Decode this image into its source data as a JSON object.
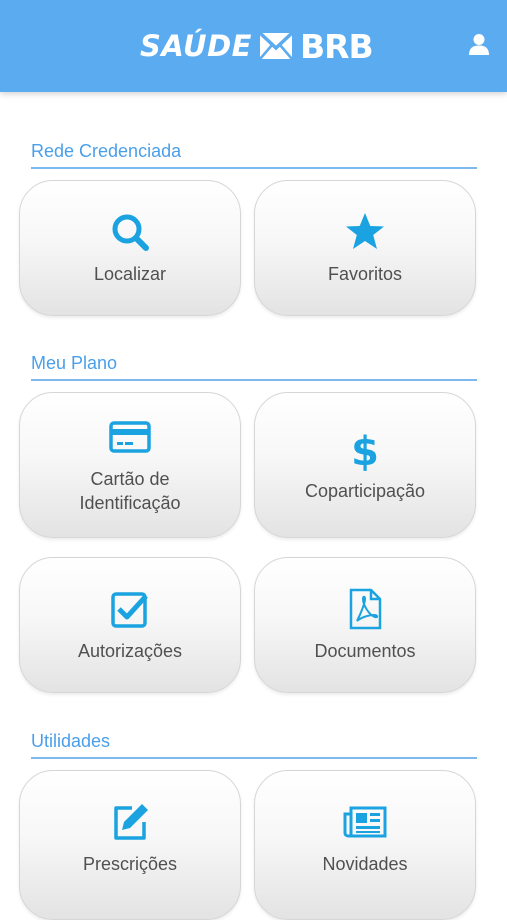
{
  "header": {
    "logo_left": "SAÚDE",
    "logo_right": "BRB",
    "user_icon": "user-icon"
  },
  "sections": [
    {
      "title": "Rede Credenciada",
      "tiles": [
        {
          "label": "Localizar",
          "icon": "search-icon"
        },
        {
          "label": "Favoritos",
          "icon": "star-icon"
        }
      ]
    },
    {
      "title": "Meu Plano",
      "tiles": [
        {
          "label": "Cartão de\nIdentificação",
          "icon": "card-icon"
        },
        {
          "label": "Coparticipação",
          "icon": "dollar-icon"
        },
        {
          "label": "Autorizações",
          "icon": "checkbox-icon"
        },
        {
          "label": "Documentos",
          "icon": "pdf-document-icon"
        }
      ]
    },
    {
      "title": "Utilidades",
      "tiles": [
        {
          "label": "Prescrições",
          "icon": "edit-icon"
        },
        {
          "label": "Novidades",
          "icon": "newspaper-icon"
        }
      ]
    }
  ],
  "colors": {
    "header": "#5aabf0",
    "accent": "#1aa3e0",
    "section_title": "#4a9fea",
    "tile_text": "#505050"
  }
}
